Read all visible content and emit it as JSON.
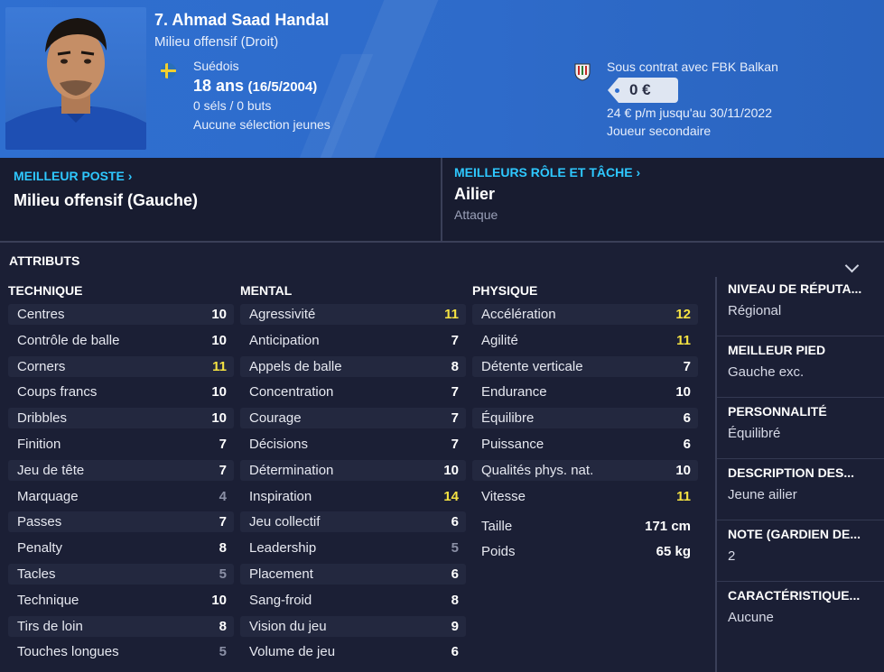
{
  "header": {
    "name": "7. Ahmad Saad Handal",
    "position": "Milieu offensif (Droit)",
    "nationality": "Suédois",
    "age": "18 ans",
    "dob": "(16/5/2004)",
    "caps": "0 séls / 0 buts",
    "youth_caps": "Aucune sélection jeunes",
    "contract_club": "Sous contrat avec FBK Balkan",
    "value": "0 €",
    "wage": "24 € p/m jusqu'au 30/11/2022",
    "squad_status": "Joueur secondaire"
  },
  "best_position": {
    "title": "MEILLEUR POSTE",
    "value": "Milieu offensif (Gauche)"
  },
  "best_role": {
    "title": "MEILLEURS RÔLE ET TÂCHE",
    "value": "Ailier",
    "duty": "Attaque"
  },
  "attributes_title": "ATTRIBUTS",
  "technical": {
    "title": "TECHNIQUE",
    "items": [
      {
        "name": "Centres",
        "value": "10"
      },
      {
        "name": "Contrôle de balle",
        "value": "10"
      },
      {
        "name": "Corners",
        "value": "11"
      },
      {
        "name": "Coups francs",
        "value": "10"
      },
      {
        "name": "Dribbles",
        "value": "10"
      },
      {
        "name": "Finition",
        "value": "7"
      },
      {
        "name": "Jeu de tête",
        "value": "7"
      },
      {
        "name": "Marquage",
        "value": "4"
      },
      {
        "name": "Passes",
        "value": "7"
      },
      {
        "name": "Penalty",
        "value": "8"
      },
      {
        "name": "Tacles",
        "value": "5"
      },
      {
        "name": "Technique",
        "value": "10"
      },
      {
        "name": "Tirs de loin",
        "value": "8"
      },
      {
        "name": "Touches longues",
        "value": "5"
      }
    ]
  },
  "mental": {
    "title": "MENTAL",
    "items": [
      {
        "name": "Agressivité",
        "value": "11"
      },
      {
        "name": "Anticipation",
        "value": "7"
      },
      {
        "name": "Appels de balle",
        "value": "8"
      },
      {
        "name": "Concentration",
        "value": "7"
      },
      {
        "name": "Courage",
        "value": "7"
      },
      {
        "name": "Décisions",
        "value": "7"
      },
      {
        "name": "Détermination",
        "value": "10"
      },
      {
        "name": "Inspiration",
        "value": "14"
      },
      {
        "name": "Jeu collectif",
        "value": "6"
      },
      {
        "name": "Leadership",
        "value": "5"
      },
      {
        "name": "Placement",
        "value": "6"
      },
      {
        "name": "Sang-froid",
        "value": "8"
      },
      {
        "name": "Vision du jeu",
        "value": "9"
      },
      {
        "name": "Volume de jeu",
        "value": "6"
      }
    ]
  },
  "physical": {
    "title": "PHYSIQUE",
    "items": [
      {
        "name": "Accélération",
        "value": "12"
      },
      {
        "name": "Agilité",
        "value": "11"
      },
      {
        "name": "Détente verticale",
        "value": "7"
      },
      {
        "name": "Endurance",
        "value": "10"
      },
      {
        "name": "Équilibre",
        "value": "6"
      },
      {
        "name": "Puissance",
        "value": "6"
      },
      {
        "name": "Qualités phys. nat.",
        "value": "10"
      },
      {
        "name": "Vitesse",
        "value": "11"
      }
    ],
    "height_label": "Taille",
    "height": "171 cm",
    "weight_label": "Poids",
    "weight": "65 kg"
  },
  "info": [
    {
      "title": "NIVEAU DE RÉPUTA...",
      "value": "Régional"
    },
    {
      "title": "MEILLEUR PIED",
      "value": "Gauche exc."
    },
    {
      "title": "PERSONNALITÉ",
      "value": "Équilibré"
    },
    {
      "title": "DESCRIPTION DES...",
      "value": "Jeune ailier"
    },
    {
      "title": "NOTE (GARDIEN DE...",
      "value": "2"
    },
    {
      "title": "CARACTÉRISTIQUE...",
      "value": "Aucune"
    }
  ],
  "colors": {
    "header_bg": "#2f6fd0",
    "accent": "#2ec8ff",
    "highlight": "#f4e242",
    "low": "#8b90a6"
  }
}
